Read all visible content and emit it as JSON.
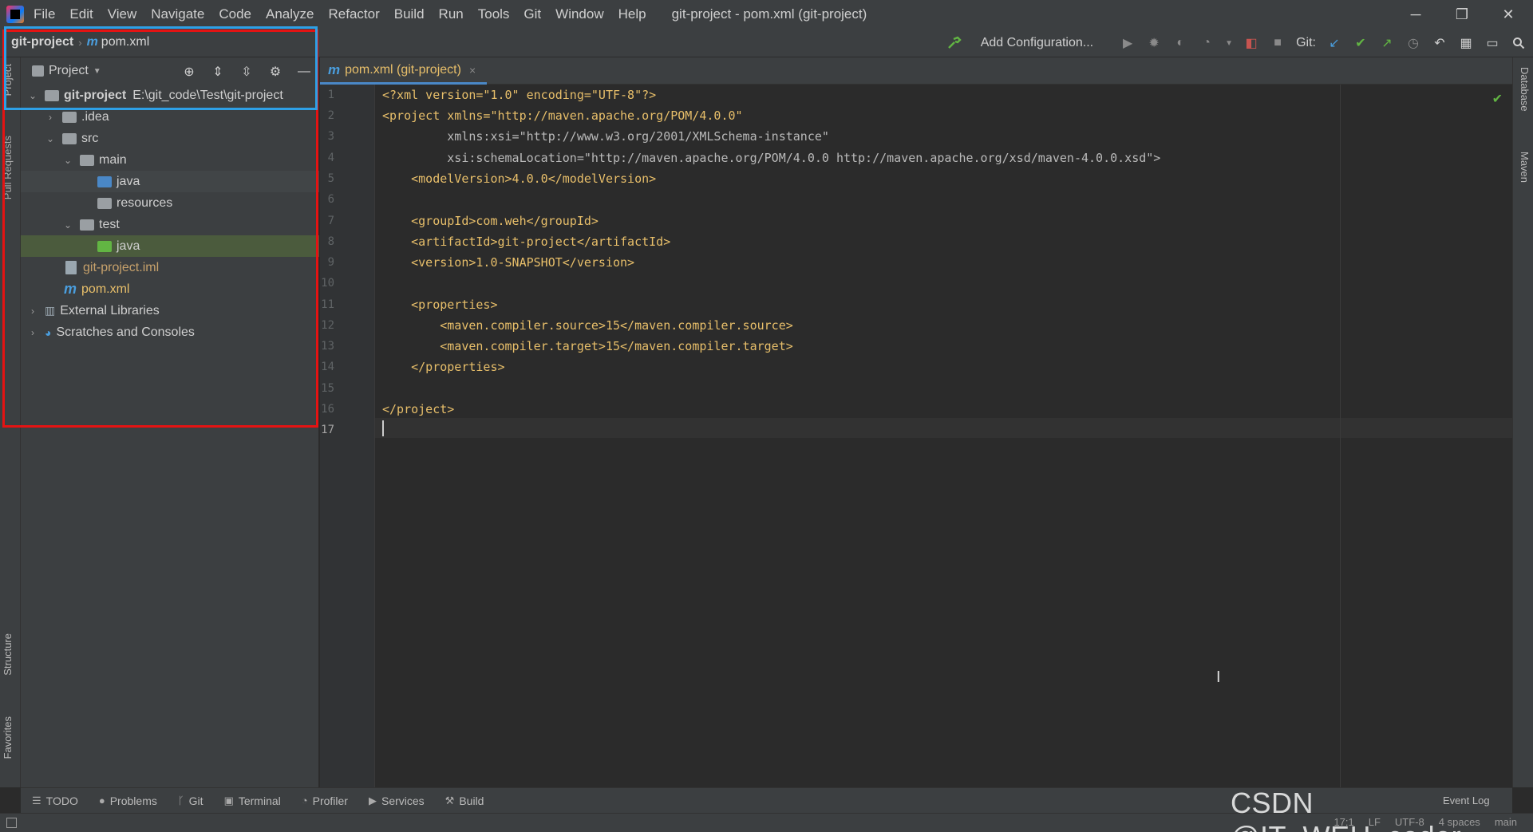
{
  "menu": [
    "File",
    "Edit",
    "View",
    "Navigate",
    "Code",
    "Analyze",
    "Refactor",
    "Build",
    "Run",
    "Tools",
    "Git",
    "Window",
    "Help"
  ],
  "window_title": "git-project - pom.xml (git-project)",
  "window_controls": {
    "minimize": "─",
    "restore": "❐",
    "close": "✕"
  },
  "breadcrumb": {
    "project": "git-project",
    "file": "pom.xml",
    "maven_glyph": "m"
  },
  "toolbar": {
    "add_configuration": "Add Configuration...",
    "git_label": "Git:"
  },
  "left_stripe": {
    "project": "Project",
    "pull_requests": "Pull Requests",
    "structure": "Structure",
    "favorites": "Favorites"
  },
  "right_stripe": {
    "database": "Database",
    "maven": "Maven"
  },
  "project_panel": {
    "title": "Project",
    "tree": [
      {
        "label": "git-project",
        "path": "E:\\git_code\\Test\\git-project"
      },
      {
        "label": ".idea"
      },
      {
        "label": "src"
      },
      {
        "label": "main"
      },
      {
        "label": "java"
      },
      {
        "label": "resources"
      },
      {
        "label": "test"
      },
      {
        "label": "java"
      },
      {
        "label": "git-project.iml"
      },
      {
        "label": "pom.xml"
      },
      {
        "label": "External Libraries"
      },
      {
        "label": "Scratches and Consoles"
      }
    ]
  },
  "editor": {
    "tab_label": "pom.xml (git-project)",
    "tab_close": "×",
    "line_numbers": [
      "1",
      "2",
      "3",
      "4",
      "5",
      "6",
      "7",
      "8",
      "9",
      "10",
      "11",
      "12",
      "13",
      "14",
      "15",
      "16",
      "17"
    ],
    "lines": [
      "<?xml version=\"1.0\" encoding=\"UTF-8\"?>",
      "<project xmlns=\"http://maven.apache.org/POM/4.0.0\"",
      "         xmlns:xsi=\"http://www.w3.org/2001/XMLSchema-instance\"",
      "         xsi:schemaLocation=\"http://maven.apache.org/POM/4.0.0 http://maven.apache.org/xsd/maven-4.0.0.xsd\">",
      "    <modelVersion>4.0.0</modelVersion>",
      "",
      "    <groupId>com.weh</groupId>",
      "    <artifactId>git-project</artifactId>",
      "    <version>1.0-SNAPSHOT</version>",
      "",
      "    <properties>",
      "        <maven.compiler.source>15</maven.compiler.source>",
      "        <maven.compiler.target>15</maven.compiler.target>",
      "    </properties>",
      "",
      "</project>",
      ""
    ]
  },
  "bottom_tabs": [
    "TODO",
    "Problems",
    "Git",
    "Terminal",
    "Profiler",
    "Services",
    "Build"
  ],
  "status": {
    "position": "17:1",
    "line_sep": "LF",
    "encoding": "UTF-8",
    "indent": "4 spaces",
    "branch": "main"
  },
  "event_log": "Event Log",
  "watermark": "CSDN @IT_WEH_coder",
  "colors": {
    "selection": "#4b5b3d",
    "red_box": "#e41313",
    "blue_box": "#2ea0e6",
    "xml_tag": "#e8bf6a",
    "xml_string": "#6a8759"
  }
}
